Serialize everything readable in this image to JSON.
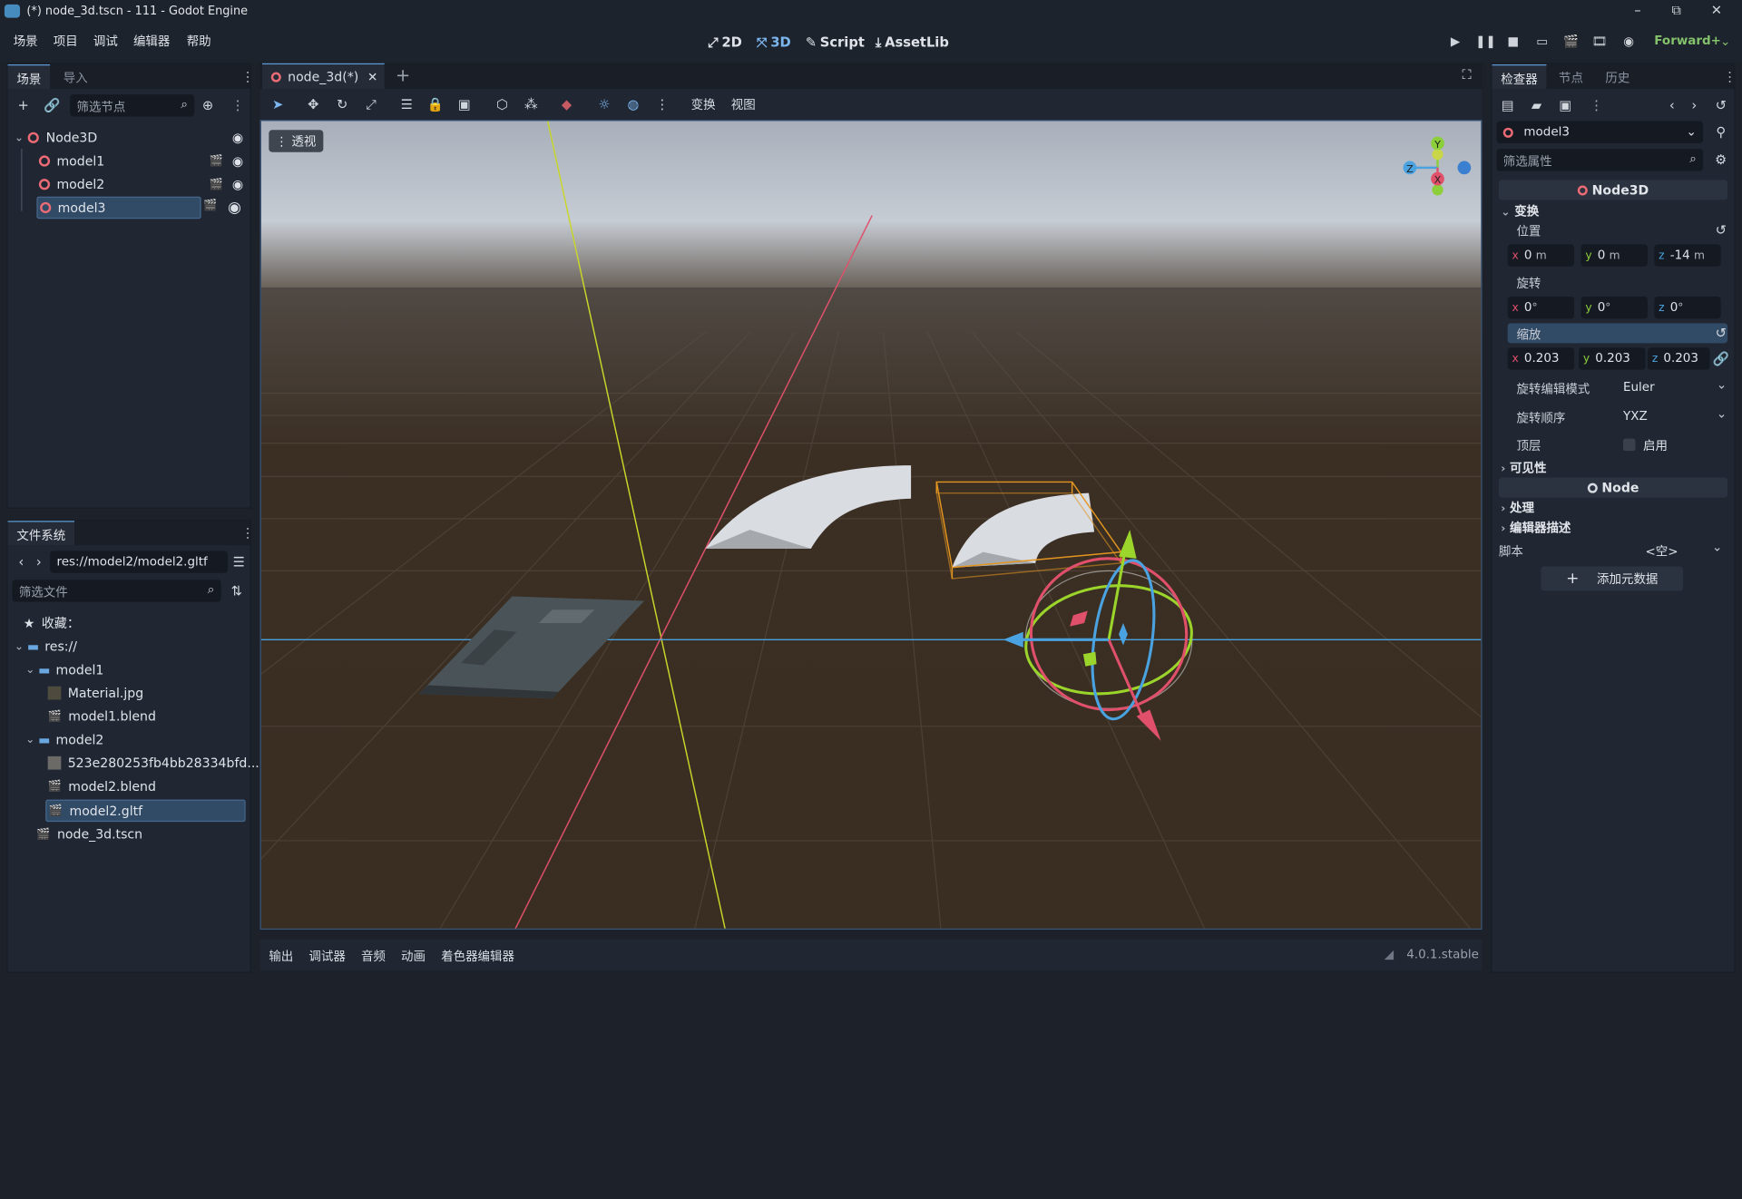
{
  "window": {
    "title": "(*) node_3d.tscn - 111 - Godot Engine",
    "minimize": "–",
    "maximize": "⧉",
    "close": "✕"
  },
  "menu": [
    "场景",
    "项目",
    "调试",
    "编辑器",
    "帮助"
  ],
  "workspaces": {
    "w2d": "2D",
    "w3d": "3D",
    "script": "Script",
    "assetlib": "AssetLib",
    "active": "3D"
  },
  "renderer": "Forward+",
  "scene_dock": {
    "tabs": [
      "场景",
      "导入"
    ],
    "filter_placeholder": "筛选节点",
    "nodes": [
      {
        "name": "Node3D",
        "root": true
      },
      {
        "name": "model1"
      },
      {
        "name": "model2"
      },
      {
        "name": "model3",
        "selected": true
      }
    ]
  },
  "filesystem": {
    "title": "文件系统",
    "path": "res://model2/model2.gltf",
    "filter_placeholder": "筛选文件",
    "favorites": "收藏：",
    "items": [
      {
        "label": "res://",
        "kind": "folder",
        "depth": 0
      },
      {
        "label": "model1",
        "kind": "folder",
        "depth": 1
      },
      {
        "label": "Material.jpg",
        "kind": "image",
        "depth": 2
      },
      {
        "label": "model1.blend",
        "kind": "scene",
        "depth": 2
      },
      {
        "label": "model2",
        "kind": "folder",
        "depth": 1
      },
      {
        "label": "523e280253fb4bb28334bfd...",
        "kind": "image",
        "depth": 2
      },
      {
        "label": "model2.blend",
        "kind": "scene",
        "depth": 2
      },
      {
        "label": "model2.gltf",
        "kind": "scene",
        "depth": 2,
        "selected": true
      },
      {
        "label": "node_3d.tscn",
        "kind": "scene",
        "depth": 1
      }
    ]
  },
  "editor_tabs": [
    {
      "label": "node_3d(*)",
      "active": true
    }
  ],
  "viewport": {
    "toolbar_menus": [
      "变换",
      "视图"
    ],
    "perspective_label": "透视",
    "gizmo_labels": {
      "y": "Y",
      "z": "Z",
      "x": "X"
    }
  },
  "bottom_panel": {
    "tabs": [
      "输出",
      "调试器",
      "音频",
      "动画",
      "着色器编辑器"
    ],
    "version": "4.0.1.stable"
  },
  "inspector": {
    "tabs": [
      "检查器",
      "节点",
      "历史"
    ],
    "object": "model3",
    "filter_placeholder": "筛选属性",
    "class_header": "Node3D",
    "transform": {
      "section": "变换",
      "position_label": "位置",
      "position": {
        "x": "0",
        "y": "0",
        "z": "-14",
        "unit": "m"
      },
      "rotation_label": "旋转",
      "rotation": {
        "x": "0",
        "y": "0",
        "z": "0",
        "unit": "°"
      },
      "scale_label": "缩放",
      "scale": {
        "x": "0.203",
        "y": "0.203",
        "z": "0.203"
      },
      "rotation_edit_mode_label": "旋转编辑模式",
      "rotation_edit_mode": "Euler",
      "rotation_order_label": "旋转顺序",
      "rotation_order": "YXZ",
      "top_level_label": "顶层",
      "top_level_value": "启用"
    },
    "visibility_section": "可见性",
    "node_header": "Node",
    "process_section": "处理",
    "editor_desc_section": "编辑器描述",
    "script_label": "脚本",
    "script_value": "<空>",
    "add_metadata": "添加元数据"
  },
  "colors": {
    "accent": "#5d9bd6",
    "node3d": "#ec6b74",
    "renderer": "#83c16b",
    "floor": "#3a2e22",
    "sky": "#bcc4cf"
  }
}
